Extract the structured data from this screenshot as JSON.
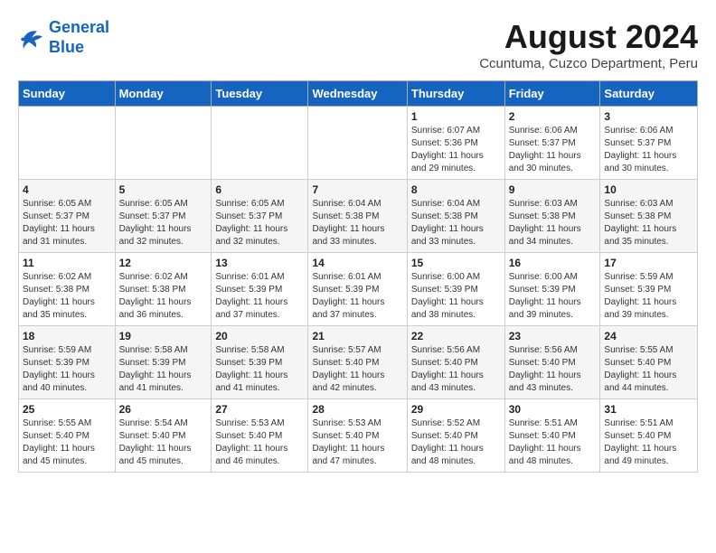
{
  "header": {
    "logo_line1": "General",
    "logo_line2": "Blue",
    "month_year": "August 2024",
    "location": "Ccuntuma, Cuzco Department, Peru"
  },
  "weekdays": [
    "Sunday",
    "Monday",
    "Tuesday",
    "Wednesday",
    "Thursday",
    "Friday",
    "Saturday"
  ],
  "weeks": [
    [
      {
        "day": "",
        "info": ""
      },
      {
        "day": "",
        "info": ""
      },
      {
        "day": "",
        "info": ""
      },
      {
        "day": "",
        "info": ""
      },
      {
        "day": "1",
        "info": "Sunrise: 6:07 AM\nSunset: 5:36 PM\nDaylight: 11 hours\nand 29 minutes."
      },
      {
        "day": "2",
        "info": "Sunrise: 6:06 AM\nSunset: 5:37 PM\nDaylight: 11 hours\nand 30 minutes."
      },
      {
        "day": "3",
        "info": "Sunrise: 6:06 AM\nSunset: 5:37 PM\nDaylight: 11 hours\nand 30 minutes."
      }
    ],
    [
      {
        "day": "4",
        "info": "Sunrise: 6:05 AM\nSunset: 5:37 PM\nDaylight: 11 hours\nand 31 minutes."
      },
      {
        "day": "5",
        "info": "Sunrise: 6:05 AM\nSunset: 5:37 PM\nDaylight: 11 hours\nand 32 minutes."
      },
      {
        "day": "6",
        "info": "Sunrise: 6:05 AM\nSunset: 5:37 PM\nDaylight: 11 hours\nand 32 minutes."
      },
      {
        "day": "7",
        "info": "Sunrise: 6:04 AM\nSunset: 5:38 PM\nDaylight: 11 hours\nand 33 minutes."
      },
      {
        "day": "8",
        "info": "Sunrise: 6:04 AM\nSunset: 5:38 PM\nDaylight: 11 hours\nand 33 minutes."
      },
      {
        "day": "9",
        "info": "Sunrise: 6:03 AM\nSunset: 5:38 PM\nDaylight: 11 hours\nand 34 minutes."
      },
      {
        "day": "10",
        "info": "Sunrise: 6:03 AM\nSunset: 5:38 PM\nDaylight: 11 hours\nand 35 minutes."
      }
    ],
    [
      {
        "day": "11",
        "info": "Sunrise: 6:02 AM\nSunset: 5:38 PM\nDaylight: 11 hours\nand 35 minutes."
      },
      {
        "day": "12",
        "info": "Sunrise: 6:02 AM\nSunset: 5:38 PM\nDaylight: 11 hours\nand 36 minutes."
      },
      {
        "day": "13",
        "info": "Sunrise: 6:01 AM\nSunset: 5:39 PM\nDaylight: 11 hours\nand 37 minutes."
      },
      {
        "day": "14",
        "info": "Sunrise: 6:01 AM\nSunset: 5:39 PM\nDaylight: 11 hours\nand 37 minutes."
      },
      {
        "day": "15",
        "info": "Sunrise: 6:00 AM\nSunset: 5:39 PM\nDaylight: 11 hours\nand 38 minutes."
      },
      {
        "day": "16",
        "info": "Sunrise: 6:00 AM\nSunset: 5:39 PM\nDaylight: 11 hours\nand 39 minutes."
      },
      {
        "day": "17",
        "info": "Sunrise: 5:59 AM\nSunset: 5:39 PM\nDaylight: 11 hours\nand 39 minutes."
      }
    ],
    [
      {
        "day": "18",
        "info": "Sunrise: 5:59 AM\nSunset: 5:39 PM\nDaylight: 11 hours\nand 40 minutes."
      },
      {
        "day": "19",
        "info": "Sunrise: 5:58 AM\nSunset: 5:39 PM\nDaylight: 11 hours\nand 41 minutes."
      },
      {
        "day": "20",
        "info": "Sunrise: 5:58 AM\nSunset: 5:39 PM\nDaylight: 11 hours\nand 41 minutes."
      },
      {
        "day": "21",
        "info": "Sunrise: 5:57 AM\nSunset: 5:40 PM\nDaylight: 11 hours\nand 42 minutes."
      },
      {
        "day": "22",
        "info": "Sunrise: 5:56 AM\nSunset: 5:40 PM\nDaylight: 11 hours\nand 43 minutes."
      },
      {
        "day": "23",
        "info": "Sunrise: 5:56 AM\nSunset: 5:40 PM\nDaylight: 11 hours\nand 43 minutes."
      },
      {
        "day": "24",
        "info": "Sunrise: 5:55 AM\nSunset: 5:40 PM\nDaylight: 11 hours\nand 44 minutes."
      }
    ],
    [
      {
        "day": "25",
        "info": "Sunrise: 5:55 AM\nSunset: 5:40 PM\nDaylight: 11 hours\nand 45 minutes."
      },
      {
        "day": "26",
        "info": "Sunrise: 5:54 AM\nSunset: 5:40 PM\nDaylight: 11 hours\nand 45 minutes."
      },
      {
        "day": "27",
        "info": "Sunrise: 5:53 AM\nSunset: 5:40 PM\nDaylight: 11 hours\nand 46 minutes."
      },
      {
        "day": "28",
        "info": "Sunrise: 5:53 AM\nSunset: 5:40 PM\nDaylight: 11 hours\nand 47 minutes."
      },
      {
        "day": "29",
        "info": "Sunrise: 5:52 AM\nSunset: 5:40 PM\nDaylight: 11 hours\nand 48 minutes."
      },
      {
        "day": "30",
        "info": "Sunrise: 5:51 AM\nSunset: 5:40 PM\nDaylight: 11 hours\nand 48 minutes."
      },
      {
        "day": "31",
        "info": "Sunrise: 5:51 AM\nSunset: 5:40 PM\nDaylight: 11 hours\nand 49 minutes."
      }
    ]
  ]
}
